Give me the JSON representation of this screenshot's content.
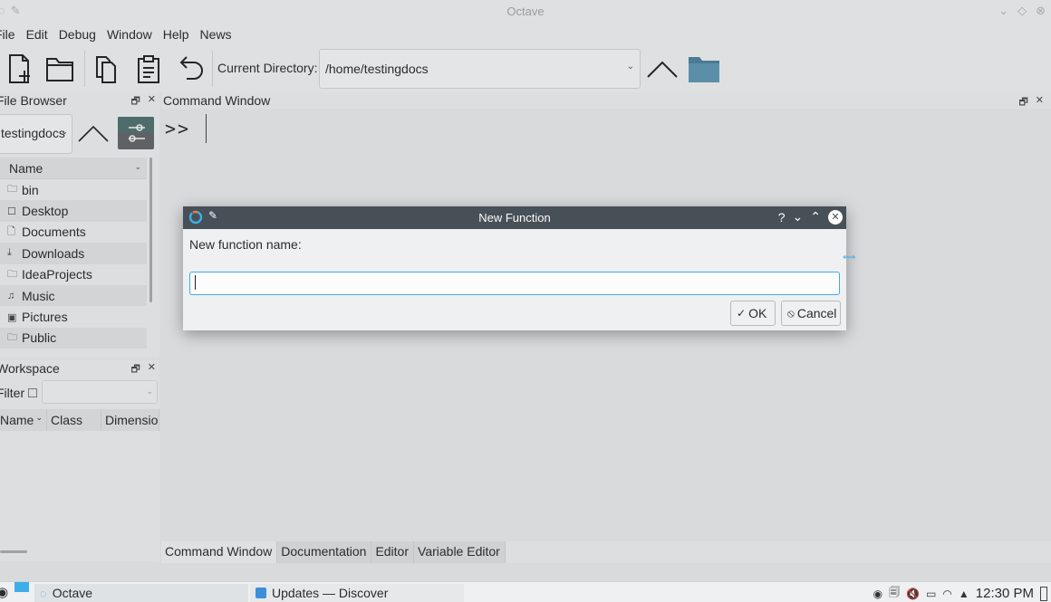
{
  "window": {
    "title": "Octave"
  },
  "menu": [
    "File",
    "Edit",
    "Debug",
    "Window",
    "Help",
    "News"
  ],
  "toolbar": {
    "current_directory_label": "Current Directory:",
    "current_directory_value": "/home/testingdocs"
  },
  "file_browser": {
    "title": "File Browser",
    "path_value": "testingdocs",
    "column_name": "Name",
    "items": [
      {
        "icon": "folder-icon",
        "glyph": "🗀",
        "name": "bin"
      },
      {
        "icon": "desktop-icon",
        "glyph": "☐",
        "name": "Desktop"
      },
      {
        "icon": "documents-icon",
        "glyph": "🗋",
        "name": "Documents"
      },
      {
        "icon": "downloads-icon",
        "glyph": "⤓",
        "name": "Downloads"
      },
      {
        "icon": "folder-icon",
        "glyph": "🗀",
        "name": "IdeaProjects"
      },
      {
        "icon": "music-icon",
        "glyph": "♫",
        "name": "Music"
      },
      {
        "icon": "pictures-icon",
        "glyph": "▣",
        "name": "Pictures"
      },
      {
        "icon": "folder-icon",
        "glyph": "🗀",
        "name": "Public"
      }
    ]
  },
  "workspace": {
    "title": "Workspace",
    "filter_label": "Filter",
    "columns": [
      "Name",
      "Class",
      "Dimensio"
    ]
  },
  "command_window": {
    "title": "Command Window",
    "prompt": ">>",
    "tabs": [
      "Command Window",
      "Documentation",
      "Editor",
      "Variable Editor"
    ]
  },
  "dialog": {
    "title": "New Function",
    "label": "New function name:",
    "input_value": "",
    "ok_label": "OK",
    "cancel_label": "Cancel"
  },
  "taskbar": {
    "tasks": [
      {
        "icon": "octave-icon",
        "label": "Octave"
      },
      {
        "icon": "discover-icon",
        "label": "Updates — Discover"
      }
    ],
    "clock": "12:30 PM"
  },
  "colors": {
    "accent": "#3daee9",
    "dialog_title_bg": "#475057"
  }
}
